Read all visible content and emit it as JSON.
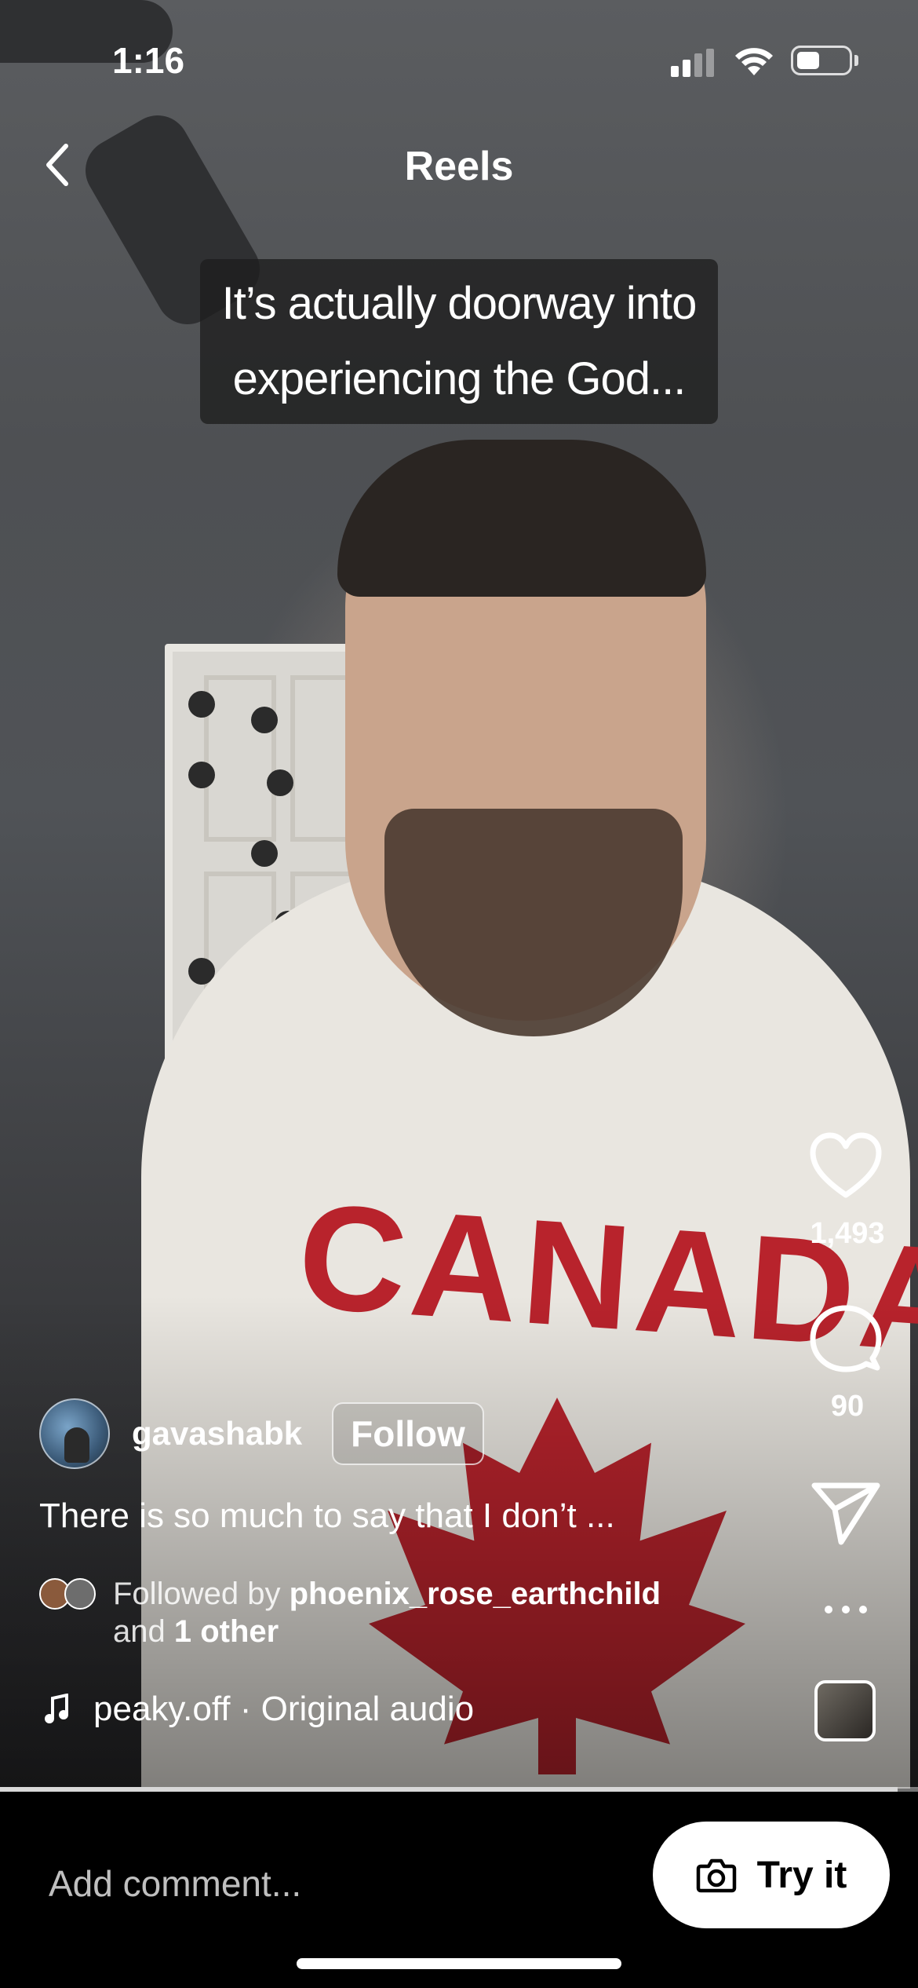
{
  "status_bar": {
    "time": "1:16"
  },
  "header": {
    "title": "Reels"
  },
  "video": {
    "caption_overlay": "It’s actually doorway into experiencing the God...",
    "shirt_text": "CANADA",
    "progress": 0.978
  },
  "actions": {
    "likes": "1,493",
    "comments": "90"
  },
  "post": {
    "username": "gavashabk",
    "follow_label": "Follow",
    "description": "There is so much to say that I don’t ...",
    "followed_prefix": "Followed by",
    "followed_user": "phoenix_rose_earthchild",
    "followed_and": "and",
    "followed_other": "1 other",
    "audio": "peaky.off · Original audio"
  },
  "bottom_bar": {
    "comment_placeholder": "Add comment...",
    "try_it_label": "Try it"
  },
  "colors": {
    "canada_red": "#b8232c",
    "background": "#000000"
  },
  "icons": [
    "back-chevron-icon",
    "heart-icon",
    "comment-icon",
    "send-icon",
    "more-icon",
    "music-note-icon",
    "camera-icon",
    "signal-icon",
    "wifi-icon",
    "battery-icon"
  ]
}
